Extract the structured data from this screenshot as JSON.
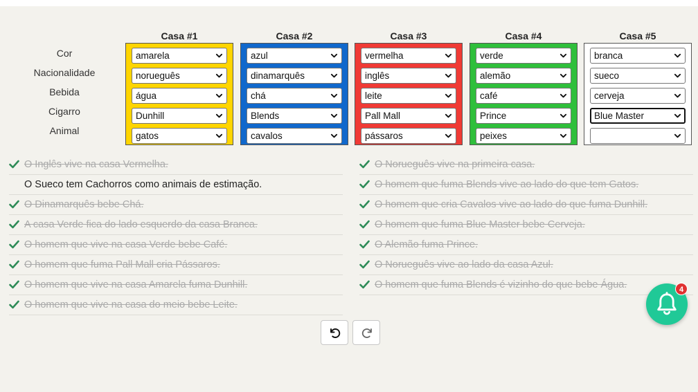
{
  "row_labels": [
    "Cor",
    "Nacionalidade",
    "Bebida",
    "Cigarro",
    "Animal"
  ],
  "houses": [
    {
      "title": "Casa #1",
      "color": "#ffd500",
      "values": [
        "amarela",
        "norueguês",
        "água",
        "Dunhill",
        "gatos"
      ]
    },
    {
      "title": "Casa #2",
      "color": "#1068cc",
      "values": [
        "azul",
        "dinamarquês",
        "chá",
        "Blends",
        "cavalos"
      ]
    },
    {
      "title": "Casa #3",
      "color": "#f03a35",
      "values": [
        "vermelha",
        "inglês",
        "leite",
        "Pall Mall",
        "pássaros"
      ]
    },
    {
      "title": "Casa #4",
      "color": "#2fbf3b",
      "values": [
        "verde",
        "alemão",
        "café",
        "Prince",
        "peixes"
      ]
    },
    {
      "title": "Casa #5",
      "color": "#ffffff",
      "values": [
        "branca",
        "sueco",
        "cerveja",
        "Blue Master",
        ""
      ]
    }
  ],
  "focused_select": {
    "house": 5,
    "row": "Cigarro"
  },
  "clues_left": [
    {
      "text": "O Inglês vive na casa Vermelha.",
      "solved": true
    },
    {
      "text": "O Sueco tem Cachorros como animais de estimação.",
      "solved": false
    },
    {
      "text": "O Dinamarquês bebe Chá.",
      "solved": true
    },
    {
      "text": "A casa Verde fica do lado esquerdo da casa Branca.",
      "solved": true
    },
    {
      "text": "O homem que vive na casa Verde bebe Café.",
      "solved": true
    },
    {
      "text": "O homem que fuma Pall Mall cria Pássaros.",
      "solved": true
    },
    {
      "text": "O homem que vive na casa Amarela fuma Dunhill.",
      "solved": true
    },
    {
      "text": "O homem que vive na casa do meio bebe Leite.",
      "solved": true
    }
  ],
  "clues_right": [
    {
      "text": "O Norueguês vive na primeira casa.",
      "solved": true
    },
    {
      "text": "O homem que fuma Blends vive ao lado do que tem Gatos.",
      "solved": true
    },
    {
      "text": "O homem que cria Cavalos vive ao lado do que fuma Dunhill.",
      "solved": true
    },
    {
      "text": "O homem que fuma Blue Master bebe Cerveja.",
      "solved": true
    },
    {
      "text": "O Alemão fuma Prince.",
      "solved": true
    },
    {
      "text": "O Norueguês vive ao lado da casa Azul.",
      "solved": true
    },
    {
      "text": "O homem que fuma Blends é vizinho do que bebe Água.",
      "solved": true
    }
  ],
  "controls": {
    "undo_icon": "undo-icon",
    "redo_icon": "redo-icon"
  },
  "notification": {
    "icon": "bell-icon",
    "count": "4",
    "accent": "#20c997",
    "badge_color": "#e03131"
  },
  "check_color": "#2e8b57"
}
